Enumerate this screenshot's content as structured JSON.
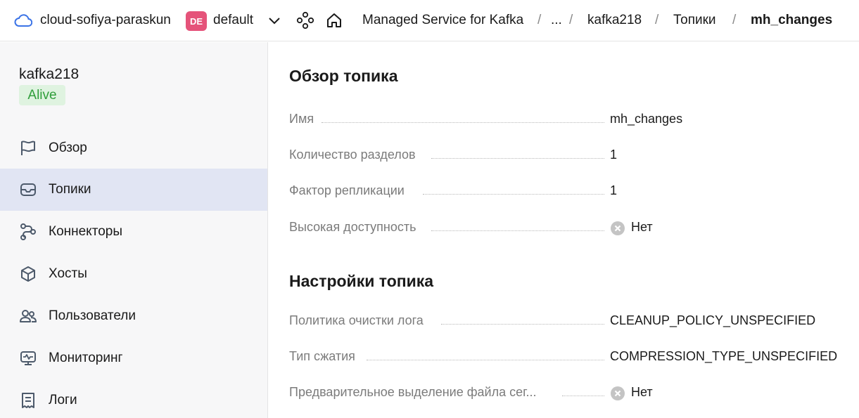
{
  "topbar": {
    "cloud_name": "cloud-sofiya-paraskun",
    "folder_badge": "DE",
    "folder_name": "default",
    "breadcrumbs": [
      "Managed Service for Kafka",
      "...",
      "kafka218",
      "Топики",
      "mh_changes"
    ],
    "separator": "/"
  },
  "sidebar": {
    "cluster_name": "kafka218",
    "status": "Alive",
    "items": [
      {
        "label": "Обзор",
        "icon": "flag-icon"
      },
      {
        "label": "Топики",
        "icon": "inbox-icon",
        "active": true
      },
      {
        "label": "Коннекторы",
        "icon": "connectors-icon"
      },
      {
        "label": "Хосты",
        "icon": "cube-icon"
      },
      {
        "label": "Пользователи",
        "icon": "users-icon"
      },
      {
        "label": "Мониторинг",
        "icon": "monitor-icon"
      },
      {
        "label": "Логи",
        "icon": "log-icon"
      }
    ]
  },
  "main": {
    "overview_title": "Обзор топика",
    "overview": [
      {
        "label": "Имя",
        "value": "mh_changes"
      },
      {
        "label": "Количество разделов",
        "value": "1"
      },
      {
        "label": "Фактор репликации",
        "value": "1"
      },
      {
        "label": "Высокая доступность",
        "value": "Нет"
      }
    ],
    "settings_title": "Настройки топика",
    "settings": [
      {
        "label": "Политика очистки лога",
        "value": "CLEANUP_POLICY_UNSPECIFIED"
      },
      {
        "label": "Тип сжатия",
        "value": "COMPRESSION_TYPE_UNSPECIFIED"
      },
      {
        "label": "Предварительное выделение файла сег...",
        "value": "Нет"
      }
    ]
  },
  "colors": {
    "accent_active": "#e1e5f3",
    "status_bg": "#dff3e0",
    "status_fg": "#2f9e3a",
    "folder_badge": "#e5537a"
  }
}
